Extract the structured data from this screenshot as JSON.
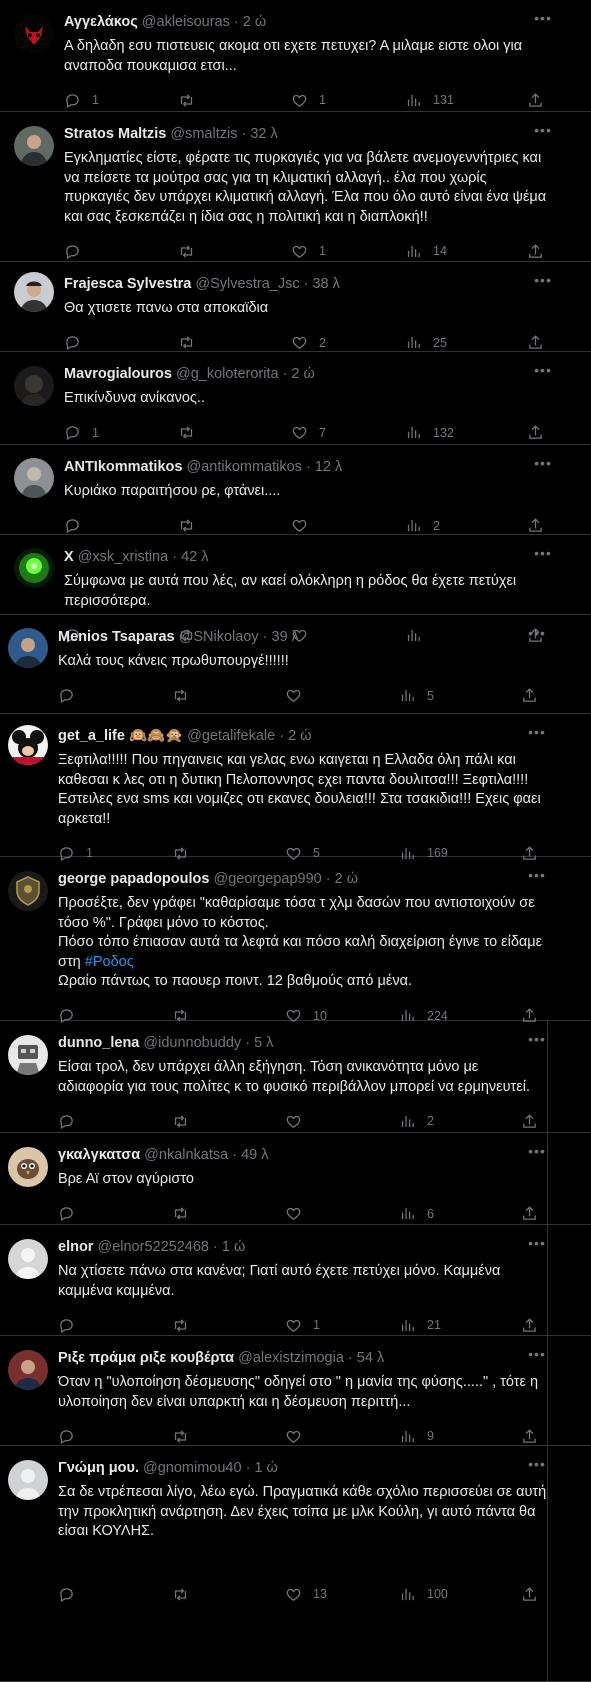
{
  "tweets": [
    {
      "name": "Αγγελάκος",
      "handle": "@akleisouras",
      "time": "2 ώ",
      "text": "Α δηλαδη εσυ πιστευεις ακομα οτι εχετε πετυχει? Α μιλαμε ειστε ολοι για\nαναποδα πουκαμισα ετσι...",
      "replies": "1",
      "retweets": "",
      "likes": "1",
      "views": "131",
      "avatar": "devil-mask"
    },
    {
      "name": "Stratos Maltzis",
      "handle": "@smaltzis",
      "time": "32 λ",
      "text": "Εγκληματίες είστε, φέρατε τις πυρκαγιές για να βάλετε ανεμογεννήτριες και\nνα πείσετε τα μούτρα σας για τη κλιματική αλλαγή.. έλα που χωρίς\nπυρκαγιές δεν υπάρχει κλιματική αλλαγή. Έλα που όλο αυτό είναι ένα ψέμα\nκαι σας ξεσκεπάζει η ίδια σας η πολιτική και η διαπλοκή!!",
      "replies": "",
      "retweets": "",
      "likes": "1",
      "views": "14",
      "avatar": "man-photo"
    },
    {
      "name": "Frajesca Sylvestra",
      "handle": "@Sylvestra_Jsc",
      "time": "38 λ",
      "text": "Θα χτισετε πανω στα αποκαϊδια",
      "replies": "",
      "retweets": "",
      "likes": "2",
      "views": "25",
      "avatar": "man-cap"
    },
    {
      "name": "Mavrogialouros",
      "handle": "@g_koloterorita",
      "time": "2 ώ",
      "text": "Επικίνδυνα ανίκανος..",
      "replies": "1",
      "retweets": "",
      "likes": "7",
      "views": "132",
      "avatar": "dark-face"
    },
    {
      "name": "ANTIkommatikos",
      "handle": "@antikommatikos",
      "time": "12 λ",
      "text": "Κυριάκο παραιτήσου ρε, φτάνει....",
      "replies": "",
      "retweets": "",
      "likes": "",
      "views": "2",
      "avatar": "bust"
    },
    {
      "name": "X",
      "handle": "@xsk_xristina",
      "time": "42 λ",
      "text": "Σύμφωνα με αυτά που λές, αν καεί ολόκληρη η ρόδος θα έχετε πετύχει\nπερισσότερα.",
      "replies": "",
      "retweets": "",
      "likes": "",
      "views": "",
      "avatar": "green-glow"
    },
    {
      "name": "Menios Tsaparas",
      "handle": "@SNikolaoy",
      "time": "39 λ",
      "text": "Καλά τους κάνεις πρωθυπουργέ!!!!!!",
      "replies": "",
      "retweets": "",
      "likes": "",
      "views": "5",
      "avatar": "man-blue"
    },
    {
      "name": "get_a_life",
      "emoji": "🙉🙈🙊",
      "handle": "@getalifekale",
      "time": "2 ώ",
      "text": "Ξεφτιλα!!!!! Που πηγαινεις και γελας ενω καιγεται η Ελλαδα όλη πάλι και\nκαθεσαι κ λες οτι η δυτικη Πελοποννησς εχει παντα δουλιτσα!!! Ξεφτιλα!!!!\nΕστειλες ενα sms και νομιζες οτι εκανες δουλεια!!! Στα τσακιδια!!! Εχεις φαει\nαρκετα!!",
      "replies": "1",
      "retweets": "",
      "likes": "5",
      "views": "169",
      "avatar": "mickey"
    },
    {
      "name": "george papadopoulos",
      "handle": "@georgepap990",
      "time": "2 ώ",
      "text_before": "Προσέξτε, δεν γράφει \"καθαρίσαμε τόσα τ χλμ δασών που αντιστοιχούν σε\nτόσο %\". Γράφει μόνο το κόστος.\nΠόσο τόπο έπιασαν αυτά τα λεφτά και πόσο καλή διαχείριση έγινε το είδαμε\nστη ",
      "hashtag": "#Ροδος",
      "text_after": "\nΩραίο πάντως το παουερ ποιντ. 12 βαθμούς από μένα.",
      "replies": "",
      "retweets": "",
      "likes": "10",
      "views": "224",
      "avatar": "emblem"
    },
    {
      "name": "dunno_lena",
      "handle": "@idunnobuddy",
      "time": "5 λ",
      "text": "Είσαι τρολ, δεν υπάρχει άλλη εξήγηση. Τόση ανικανότητα μόνο με\nαδιαφορία για τους πολίτες κ το φυσικό περιβάλλον μπορεί να ερμηνευτεί.",
      "replies": "",
      "retweets": "",
      "likes": "",
      "views": "2",
      "avatar": "robot"
    },
    {
      "name": "γκαλγκατσα",
      "handle": "@nkalnkatsa",
      "time": "49 λ",
      "text": "Βρε Αϊ στον αγύριστο",
      "replies": "",
      "retweets": "",
      "likes": "",
      "views": "6",
      "avatar": "bird"
    },
    {
      "name": "elnor",
      "handle": "@elnor52252468",
      "time": "1 ώ",
      "text": "Να χτίσετε πάνω στα κανένα; Γιατί αυτό έχετε πετύχει μόνο. Καμμένα\nκαμμένα καμμένα.",
      "replies": "",
      "retweets": "",
      "likes": "1",
      "views": "21",
      "avatar": "default"
    },
    {
      "name": "Ριξε πράμα ριξε κουβέρτα",
      "handle": "@alexistzimogia",
      "time": "54 λ",
      "text": "Όταν η \"υλοποίηση δέσμευσης\" οδηγεί στο \" η μανία της φύσης.....\" , τότε η\nυλοποίηση δεν είναι υπαρκτή και η δέσμευση περιττή...",
      "replies": "",
      "retweets": "",
      "likes": "",
      "views": "9",
      "avatar": "man-red"
    },
    {
      "name": "Γνώμη μου.",
      "handle": "@gnomimou40",
      "time": "1 ώ",
      "text": "Σα δε ντρέπεσαι λίγο, λέω εγώ. Πραγματικά κάθε σχόλιο περισσεύει σε αυτή\nτην προκλητική ανάρτηση. Δεν έχεις τσίπα με μλκ Κούλη, γι αυτό πάντα θα\nείσαι ΚΟΥΛΗΣ.",
      "replies": "",
      "retweets": "",
      "likes": "13",
      "views": "100",
      "avatar": "default2"
    }
  ]
}
